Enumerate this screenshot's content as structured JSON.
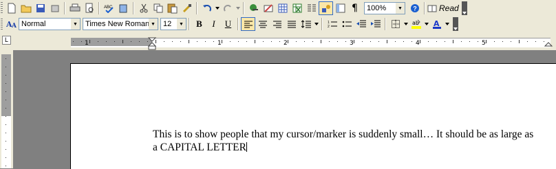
{
  "toolbar": {
    "zoom": "100%",
    "read_label": "Read",
    "icons": [
      "new-icon",
      "open-icon",
      "save-icon",
      "permission-icon",
      "print-icon",
      "print-preview-icon",
      "spelling-icon",
      "research-icon",
      "cut-icon",
      "copy-icon",
      "paste-icon",
      "format-painter-icon",
      "undo-icon",
      "redo-icon",
      "hyperlink-icon",
      "tables-borders-icon",
      "insert-table-icon",
      "insert-excel-icon",
      "columns-icon",
      "drawing-icon",
      "document-map-icon",
      "show-hide-icon",
      "help-icon",
      "read-icon"
    ]
  },
  "format": {
    "style": "Normal",
    "font": "Times New Roman",
    "size": "12",
    "bold": "B",
    "italic": "I",
    "underline": "U",
    "font_color": "#1a38c8",
    "highlight_color": "#ffff00"
  },
  "ruler": {
    "numbers": [
      "1",
      "1",
      "2",
      "3",
      "4",
      "5"
    ]
  },
  "document": {
    "line1": "This is to show people that my cursor/marker is suddenly small… It should be as large as",
    "line2": "a CAPITAL LETTER"
  }
}
